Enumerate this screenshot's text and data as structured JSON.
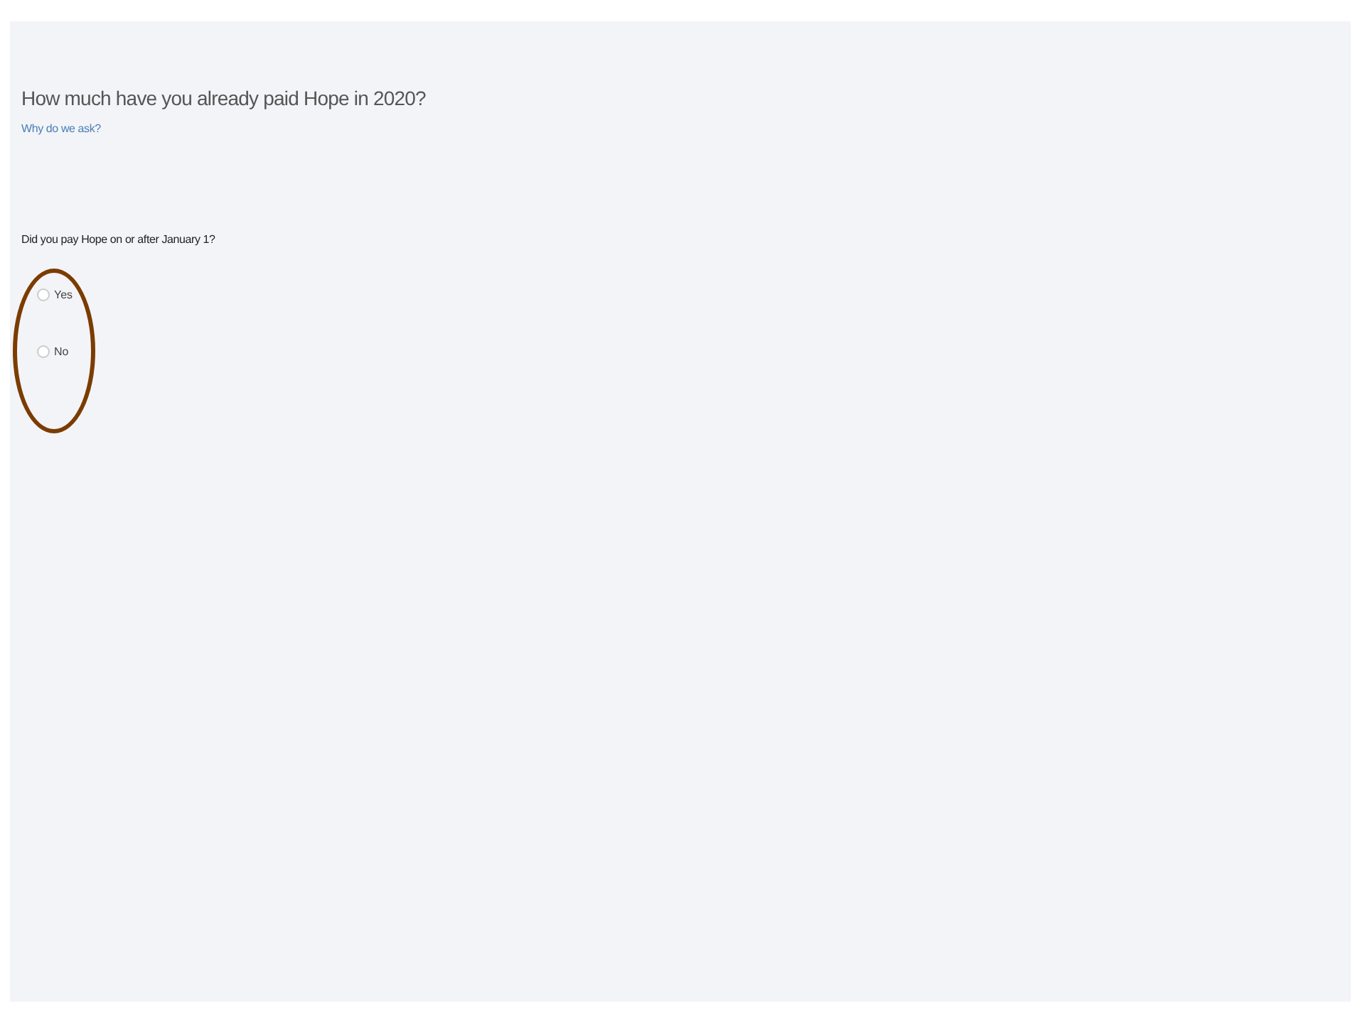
{
  "heading": "How much have you already paid Hope in 2020?",
  "help_link": "Why do we ask?",
  "question": "Did you pay Hope on or after January 1?",
  "options": [
    {
      "label": "Yes",
      "selected": false
    },
    {
      "label": "No",
      "selected": false
    }
  ]
}
